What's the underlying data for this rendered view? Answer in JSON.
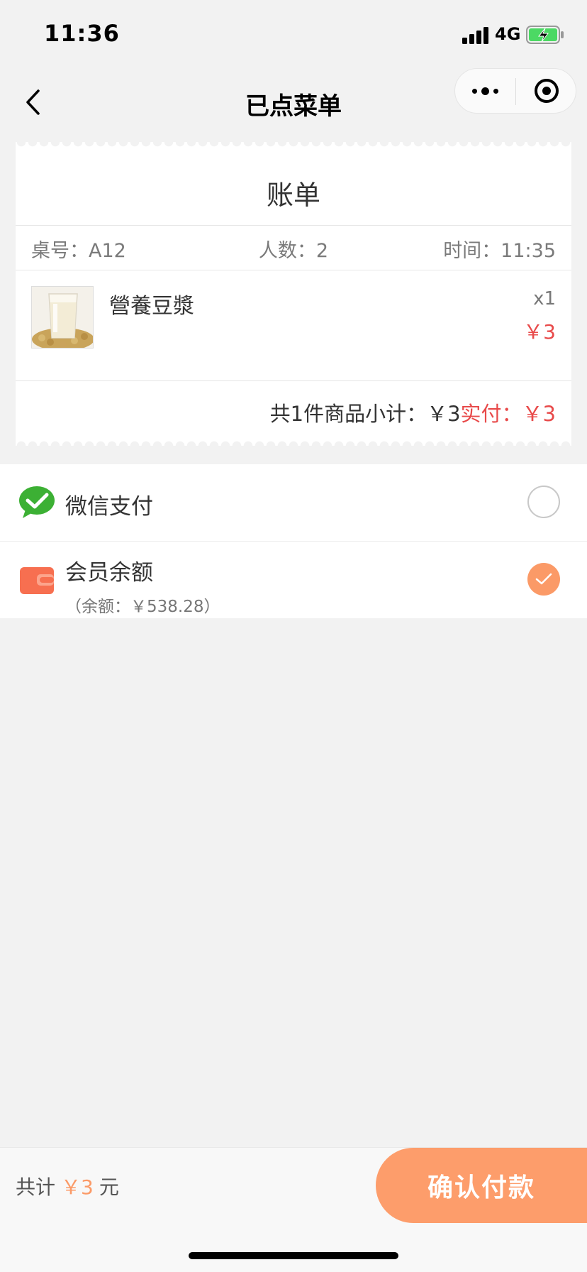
{
  "status_bar": {
    "time": "11:36",
    "network": "4G"
  },
  "nav": {
    "title": "已点菜单"
  },
  "bill": {
    "title": "账单",
    "table": "桌号：A12",
    "people": "人数：2",
    "time": "时间：11:35",
    "items": [
      {
        "name": "營養豆漿",
        "quantity": "x1",
        "price": "￥3"
      }
    ],
    "summary": "共1件商品小计：￥3",
    "paid_label": "实付：",
    "paid_amount": "￥3"
  },
  "payment": {
    "wechat": {
      "label": "微信支付",
      "icon": "wechat-icon",
      "selected": false
    },
    "member": {
      "label": "会员余额",
      "balance": "（余额：￥538.28）",
      "icon": "wallet-icon",
      "selected": true
    }
  },
  "bottom": {
    "total_prefix": "共计",
    "total_amount": "￥3",
    "total_suffix": "元",
    "confirm_label": "确认付款"
  },
  "colors": {
    "accent": "#fd9d6b",
    "price_red": "#e84a4a",
    "wechat_green": "#3cb034"
  }
}
